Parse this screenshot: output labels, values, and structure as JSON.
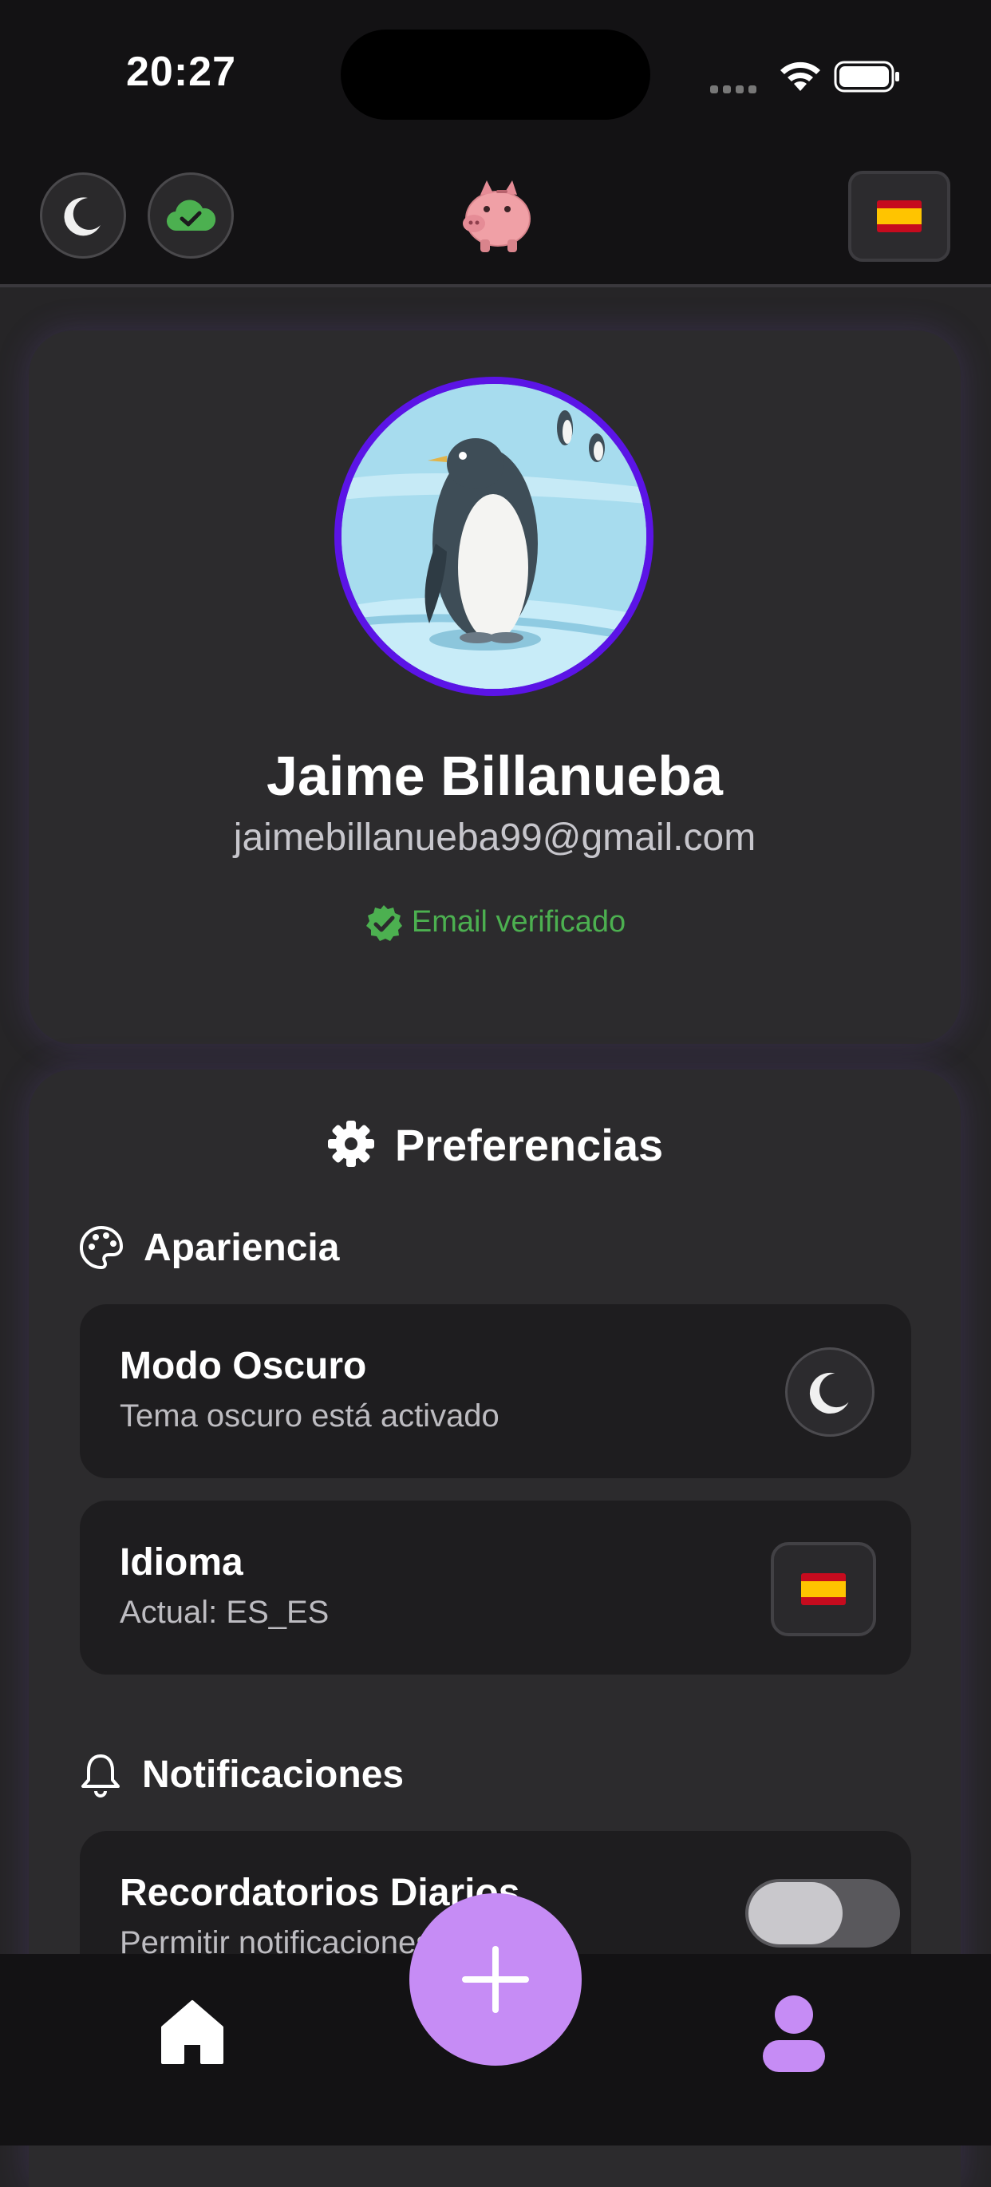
{
  "status_bar": {
    "time": "20:27"
  },
  "header": {
    "theme_button": "moon-icon",
    "sync_button": "cloud-check-icon",
    "logo": "piggy-bank-logo",
    "language_flag": "spain-flag"
  },
  "profile": {
    "name": "Jaime Billanueba",
    "email": "jaimebillanueba99@gmail.com",
    "verified_label": "Email verificado"
  },
  "preferences": {
    "title": "Preferencias",
    "appearance": {
      "heading": "Apariencia",
      "dark_mode": {
        "title": "Modo Oscuro",
        "subtitle": "Tema oscuro está activado"
      },
      "language": {
        "title": "Idioma",
        "subtitle": "Actual: ES_ES"
      }
    },
    "notifications": {
      "heading": "Notificaciones",
      "daily_reminders": {
        "title": "Recordatorios Diarios",
        "subtitle": "Permitir notificaciones",
        "enabled": false
      }
    }
  },
  "colors": {
    "accent": "#c68cf5",
    "avatar_ring": "#5b14e6",
    "verified": "#4cb050"
  }
}
